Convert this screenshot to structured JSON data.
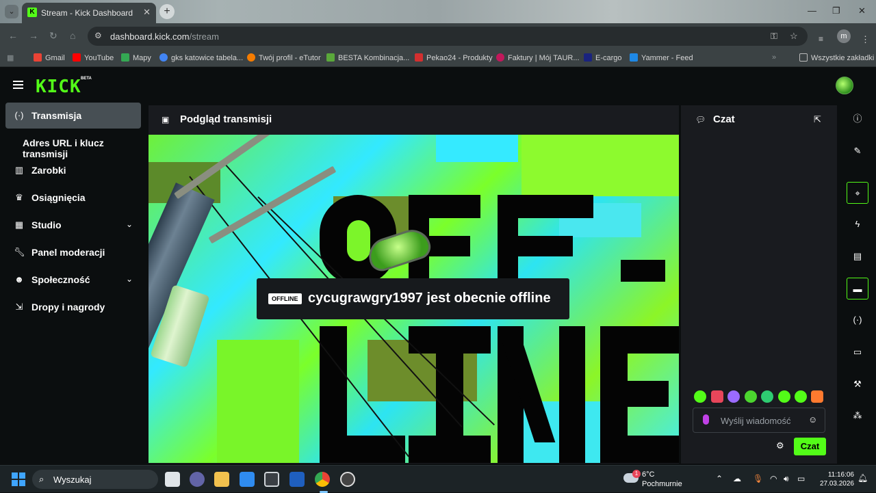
{
  "browser": {
    "tab_title": "Stream - Kick Dashboard",
    "tab_favicon_letter": "K",
    "new_tab": "+",
    "url_host": "dashboard.kick.com",
    "url_path": "/stream",
    "profile_initial": "m",
    "bookmarks": [
      {
        "label": "Gmail",
        "color": "#ea4335"
      },
      {
        "label": "YouTube",
        "color": "#ff0000"
      },
      {
        "label": "Mapy",
        "color": "#34a853"
      },
      {
        "label": "gks katowice tabela...",
        "color": "#4285f4"
      },
      {
        "label": "Twój profil - eTutor",
        "color": "#f57c00"
      },
      {
        "label": "BESTA Kombinacja...",
        "color": "#5aa83a"
      },
      {
        "label": "Pekao24 - Produkty",
        "color": "#d32f2f"
      },
      {
        "label": "Faktury | Mój TAUR...",
        "color": "#c2185b"
      },
      {
        "label": "E-cargo",
        "color": "#1a237e"
      },
      {
        "label": "Yammer - Feed",
        "color": "#1e88e5"
      }
    ],
    "all_bookmarks": "Wszystkie zakładki"
  },
  "app": {
    "logo": "KICK",
    "beta": "BETA",
    "sidebar": {
      "items": [
        {
          "label": "Transmisja",
          "icon": "broadcast-icon",
          "active": true
        },
        {
          "label": "Zarobki",
          "icon": "chart-icon"
        },
        {
          "label": "Osiągnięcia",
          "icon": "trophy-icon"
        },
        {
          "label": "Studio",
          "icon": "studio-icon",
          "expandable": true
        },
        {
          "label": "Panel moderacji",
          "icon": "wrench-icon"
        },
        {
          "label": "Społeczność",
          "icon": "people-icon",
          "expandable": true
        },
        {
          "label": "Dropy i nagrody",
          "icon": "drops-icon"
        }
      ],
      "subitem": "Adres URL i klucz transmisji"
    },
    "preview": {
      "title": "Podgląd transmisji",
      "offline_badge": "OFFLINE",
      "offline_message": "cycugrawgry1997 jest obecnie offline",
      "art_text_top": "OFF-",
      "art_text_bottom": "LINE"
    },
    "chat": {
      "title": "Czat",
      "input_placeholder": "Wyślij wiadomość",
      "send_label": "Czat",
      "emote_colors": [
        "#53fc18",
        "#e8465a",
        "#9b6bff",
        "#4cd62f",
        "#2ecc71",
        "#53fc18",
        "#53fc18",
        "#ff7a2f"
      ]
    },
    "right_rail": [
      "info-icon",
      "pencil-icon",
      "scan-icon",
      "lightning-icon",
      "notes-icon",
      "chat-bubble-icon",
      "broadcast-icon",
      "video-icon",
      "wrench-icon",
      "nodes-icon"
    ]
  },
  "taskbar": {
    "search_label": "Wyszukaj",
    "weather_badge": "1",
    "weather_temp": "6°C",
    "weather_cond": "Pochmurnie",
    "time": "11:16:06",
    "date": "27.03.2026"
  }
}
